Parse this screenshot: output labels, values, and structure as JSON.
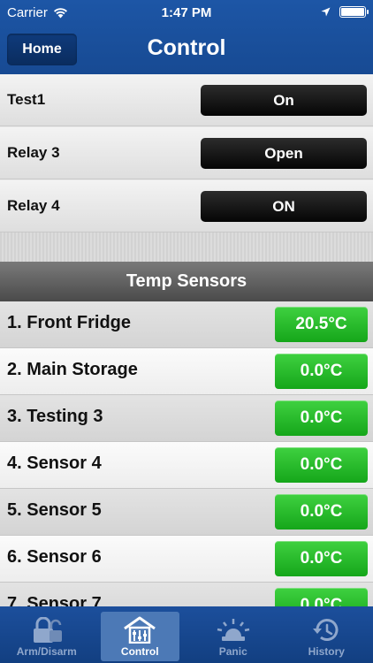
{
  "status_bar": {
    "carrier": "Carrier",
    "time": "1:47 PM"
  },
  "nav": {
    "home_label": "Home",
    "title": "Control"
  },
  "relays": [
    {
      "label": "Test1",
      "button": "On"
    },
    {
      "label": "Relay 3",
      "button": "Open"
    },
    {
      "label": "Relay 4",
      "button": "ON"
    }
  ],
  "sensors": {
    "header": "Temp Sensors",
    "items": [
      {
        "label": "1. Front Fridge",
        "value": "20.5°C"
      },
      {
        "label": "2. Main Storage",
        "value": "0.0°C"
      },
      {
        "label": "3. Testing 3",
        "value": "0.0°C"
      },
      {
        "label": "4. Sensor 4",
        "value": "0.0°C"
      },
      {
        "label": "5. Sensor 5",
        "value": "0.0°C"
      },
      {
        "label": "6. Sensor 6",
        "value": "0.0°C"
      },
      {
        "label": "7. Sensor 7",
        "value": "0.0°C"
      }
    ]
  },
  "tabs": [
    {
      "label": "Arm/Disarm",
      "icon": "lock-icon",
      "active": false
    },
    {
      "label": "Control",
      "icon": "house-sliders-icon",
      "active": true
    },
    {
      "label": "Panic",
      "icon": "siren-icon",
      "active": false
    },
    {
      "label": "History",
      "icon": "history-icon",
      "active": false
    }
  ],
  "colors": {
    "nav_blue": "#1d56a6",
    "sensor_green": "#15a61a",
    "relay_button": "#050505"
  }
}
